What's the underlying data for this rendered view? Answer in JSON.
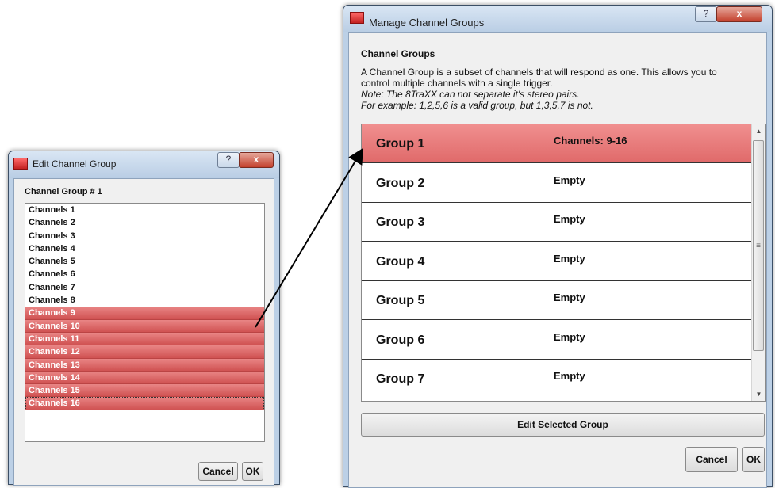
{
  "edit_dialog": {
    "title": "Edit Channel Group",
    "help_label": "?",
    "close_label": "x",
    "heading": "Channel Group # 1",
    "channels": [
      {
        "label": "Channels 1",
        "selected": false
      },
      {
        "label": "Channels 2",
        "selected": false
      },
      {
        "label": "Channels 3",
        "selected": false
      },
      {
        "label": "Channels 4",
        "selected": false
      },
      {
        "label": "Channels 5",
        "selected": false
      },
      {
        "label": "Channels 6",
        "selected": false
      },
      {
        "label": "Channels 7",
        "selected": false
      },
      {
        "label": "Channels 8",
        "selected": false
      },
      {
        "label": "Channels 9",
        "selected": true
      },
      {
        "label": "Channels 10",
        "selected": true
      },
      {
        "label": "Channels 11",
        "selected": true
      },
      {
        "label": "Channels 12",
        "selected": true
      },
      {
        "label": "Channels 13",
        "selected": true
      },
      {
        "label": "Channels 14",
        "selected": true
      },
      {
        "label": "Channels 15",
        "selected": true
      },
      {
        "label": "Channels 16",
        "selected": true
      }
    ],
    "cancel_label": "Cancel",
    "ok_label": "OK"
  },
  "manage_dialog": {
    "title": "Manage Channel Groups",
    "help_label": "?",
    "close_label": "x",
    "heading": "Channel Groups",
    "description_line1": "A Channel Group is a subset of channels that will respond as one.  This allows you to",
    "description_line2": "control multiple channels with a single trigger.",
    "note_line1": "Note: The 8TraXX can not separate it's stereo pairs.",
    "note_line2": "For example: 1,2,5,6 is a valid group, but 1,3,5,7 is not.",
    "groups": [
      {
        "name": "Group 1",
        "status": "Channels: 9-16",
        "selected": true
      },
      {
        "name": "Group 2",
        "status": "Empty",
        "selected": false
      },
      {
        "name": "Group 3",
        "status": "Empty",
        "selected": false
      },
      {
        "name": "Group 4",
        "status": "Empty",
        "selected": false
      },
      {
        "name": "Group 5",
        "status": "Empty",
        "selected": false
      },
      {
        "name": "Group 6",
        "status": "Empty",
        "selected": false
      },
      {
        "name": "Group 7",
        "status": "Empty",
        "selected": false
      }
    ],
    "scroll_up_glyph": "▲",
    "scroll_down_glyph": "▼",
    "scroll_grip_glyph": "≡",
    "edit_selected_label": "Edit Selected Group",
    "cancel_label": "Cancel",
    "ok_label": "OK"
  },
  "colors": {
    "selection": "#e06a6a",
    "window_frame": "#bcd0e6"
  }
}
